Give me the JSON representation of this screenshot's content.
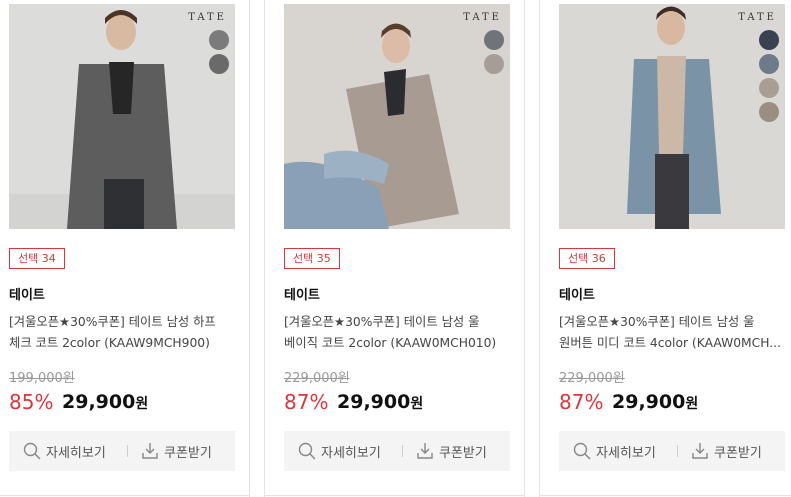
{
  "products": [
    {
      "brand_mark": "TATE",
      "badge": "선택 34",
      "brand": "테이트",
      "title_line1": "[겨울오픈★30%쿠폰] 테이트 남성 하프",
      "title_line2": "체크 코트 2color (KAAW9MCH900)",
      "original_price": "199,000원",
      "discount": "85%",
      "price": "29,900",
      "price_unit": "원",
      "detail_label": "자세히보기",
      "coupon_label": "쿠폰받기",
      "swatch_colors": [
        "#7b7b7b",
        "#6a6a6a"
      ],
      "coat_color": "#5d5d5d"
    },
    {
      "brand_mark": "TATE",
      "badge": "선택 35",
      "brand": "테이트",
      "title_line1": "[겨울오픈★30%쿠폰] 테이트 남성 울",
      "title_line2": "베이직 코트 2color (KAAW0MCH010)",
      "original_price": "229,000원",
      "discount": "87%",
      "price": "29,900",
      "price_unit": "원",
      "detail_label": "자세히보기",
      "coupon_label": "쿠폰받기",
      "swatch_colors": [
        "#6e7478",
        "#a69d96"
      ],
      "coat_color": "#a89c92"
    },
    {
      "brand_mark": "TATE",
      "badge": "선택 36",
      "brand": "테이트",
      "title_line1": "[겨울오픈★30%쿠폰] 테이트 남성 울",
      "title_line2": "원버튼 미디 코트 4color (KAAW0MCH...",
      "original_price": "229,000원",
      "discount": "87%",
      "price": "29,900",
      "price_unit": "원",
      "detail_label": "자세히보기",
      "coupon_label": "쿠폰받기",
      "swatch_colors": [
        "#3a4150",
        "#6c7a89",
        "#a89e94",
        "#9a8e80"
      ],
      "coat_color": "#7b93a6"
    }
  ]
}
